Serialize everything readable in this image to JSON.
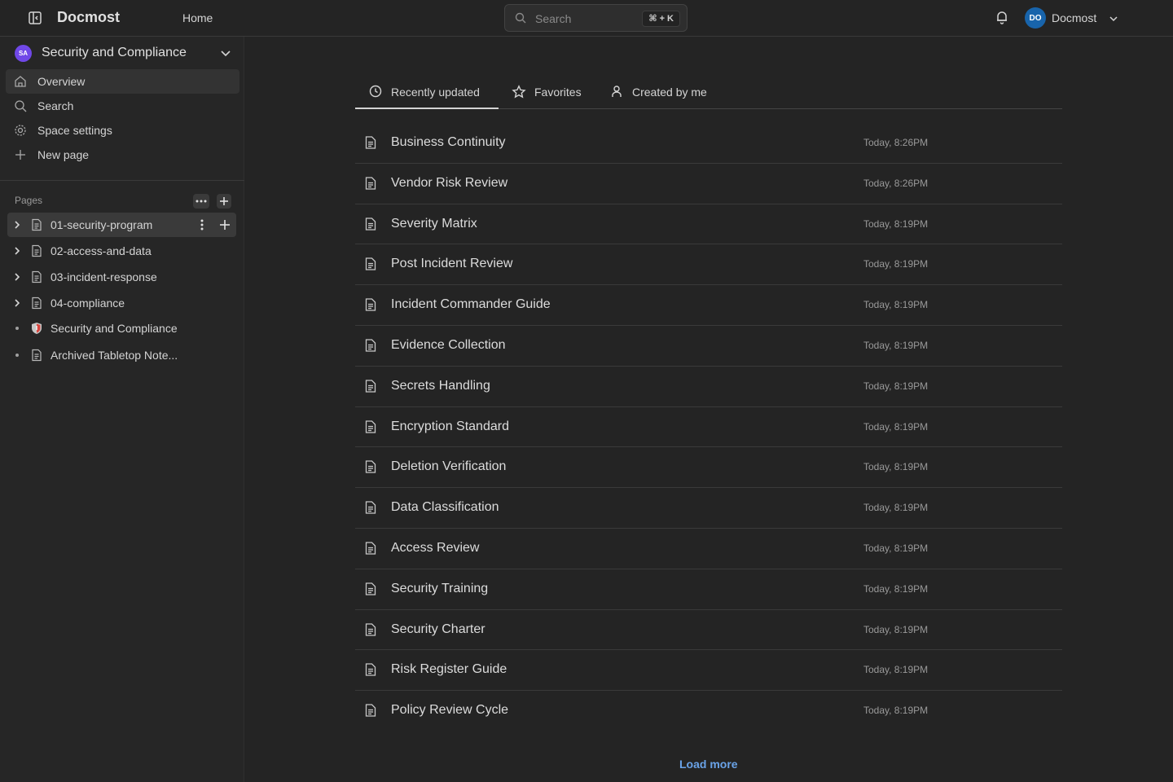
{
  "header": {
    "app_name": "Docmost",
    "nav_home": "Home",
    "search_placeholder": "Search",
    "search_shortcut": "⌘ + K",
    "user_initials": "DO",
    "user_name": "Docmost"
  },
  "sidebar": {
    "space_initials": "SA",
    "space_name": "Security and Compliance",
    "menu": [
      {
        "label": "Overview",
        "icon": "home-icon"
      },
      {
        "label": "Search",
        "icon": "search-icon"
      },
      {
        "label": "Space settings",
        "icon": "gear-icon"
      },
      {
        "label": "New page",
        "icon": "plus-icon"
      }
    ],
    "pages_label": "Pages",
    "pages": [
      {
        "label": "01-security-program",
        "expandable": true,
        "icon": "document-icon"
      },
      {
        "label": "02-access-and-data",
        "expandable": true,
        "icon": "document-icon"
      },
      {
        "label": "03-incident-response",
        "expandable": true,
        "icon": "document-icon"
      },
      {
        "label": "04-compliance",
        "expandable": true,
        "icon": "document-icon"
      },
      {
        "label": "Security and Compliance",
        "expandable": false,
        "icon": "shield-emoji-icon"
      },
      {
        "label": "Archived Tabletop Note...",
        "expandable": false,
        "icon": "document-icon"
      }
    ]
  },
  "main": {
    "tabs": [
      {
        "label": "Recently updated",
        "icon": "clock-icon"
      },
      {
        "label": "Favorites",
        "icon": "star-icon"
      },
      {
        "label": "Created by me",
        "icon": "user-icon"
      }
    ],
    "rows": [
      {
        "title": "Business Continuity",
        "time": "Today, 8:26PM"
      },
      {
        "title": "Vendor Risk Review",
        "time": "Today, 8:26PM"
      },
      {
        "title": "Severity Matrix",
        "time": "Today, 8:19PM"
      },
      {
        "title": "Post Incident Review",
        "time": "Today, 8:19PM"
      },
      {
        "title": "Incident Commander Guide",
        "time": "Today, 8:19PM"
      },
      {
        "title": "Evidence Collection",
        "time": "Today, 8:19PM"
      },
      {
        "title": "Secrets Handling",
        "time": "Today, 8:19PM"
      },
      {
        "title": "Encryption Standard",
        "time": "Today, 8:19PM"
      },
      {
        "title": "Deletion Verification",
        "time": "Today, 8:19PM"
      },
      {
        "title": "Data Classification",
        "time": "Today, 8:19PM"
      },
      {
        "title": "Access Review",
        "time": "Today, 8:19PM"
      },
      {
        "title": "Security Training",
        "time": "Today, 8:19PM"
      },
      {
        "title": "Security Charter",
        "time": "Today, 8:19PM"
      },
      {
        "title": "Risk Register Guide",
        "time": "Today, 8:19PM"
      },
      {
        "title": "Policy Review Cycle",
        "time": "Today, 8:19PM"
      }
    ],
    "load_more": "Load more"
  },
  "colors": {
    "background": "#242424",
    "accent_link": "#6aa3e8",
    "user_avatar": "#1864ab",
    "space_avatar": "#7048e8"
  }
}
